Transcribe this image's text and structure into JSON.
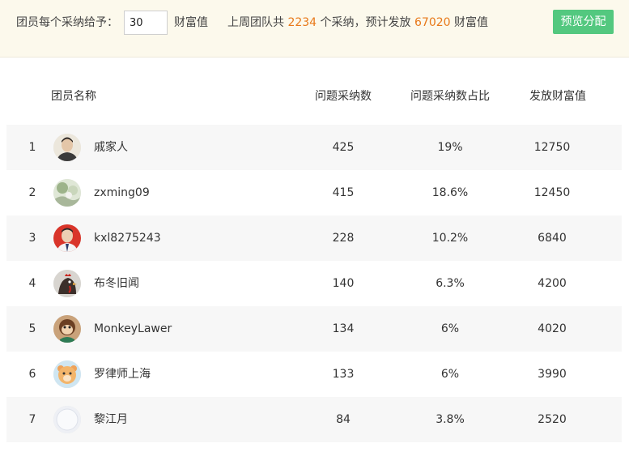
{
  "toolbar": {
    "label_prefix": "团员每个采纳给予：",
    "quantity_value": "30",
    "label_unit": "财富值",
    "summary_prefix": "上周团队共",
    "adoption_total": "2234",
    "summary_mid": "个采纳，预计发放",
    "wealth_total": "67020",
    "summary_suffix": "财富值",
    "preview_button": "预览分配",
    "accent_color": "#e8791a",
    "button_color": "#53c87f"
  },
  "table": {
    "headers": {
      "name": "团员名称",
      "count": "问题采纳数",
      "ratio": "问题采纳数占比",
      "value": "发放财富值"
    },
    "rows": [
      {
        "rank": "1",
        "name": "戚家人",
        "count": "425",
        "ratio": "19%",
        "value": "12750",
        "avatar": "man-portrait-avatar"
      },
      {
        "rank": "2",
        "name": "zxming09",
        "count": "415",
        "ratio": "18.6%",
        "value": "12450",
        "avatar": "landscape-avatar"
      },
      {
        "rank": "3",
        "name": "kxl8275243",
        "count": "228",
        "ratio": "10.2%",
        "value": "6840",
        "avatar": "man-red-background-avatar"
      },
      {
        "rank": "4",
        "name": "布冬旧闻",
        "count": "140",
        "ratio": "6.3%",
        "value": "4200",
        "avatar": "rooster-avatar"
      },
      {
        "rank": "5",
        "name": "MonkeyLawer",
        "count": "134",
        "ratio": "6%",
        "value": "4020",
        "avatar": "cartoon-monkey-avatar"
      },
      {
        "rank": "6",
        "name": "罗律师上海",
        "count": "133",
        "ratio": "6%",
        "value": "3990",
        "avatar": "cartoon-bear-avatar"
      },
      {
        "rank": "7",
        "name": "黎江月",
        "count": "84",
        "ratio": "3.8%",
        "value": "2520",
        "avatar": "default-user-avatar"
      }
    ]
  }
}
